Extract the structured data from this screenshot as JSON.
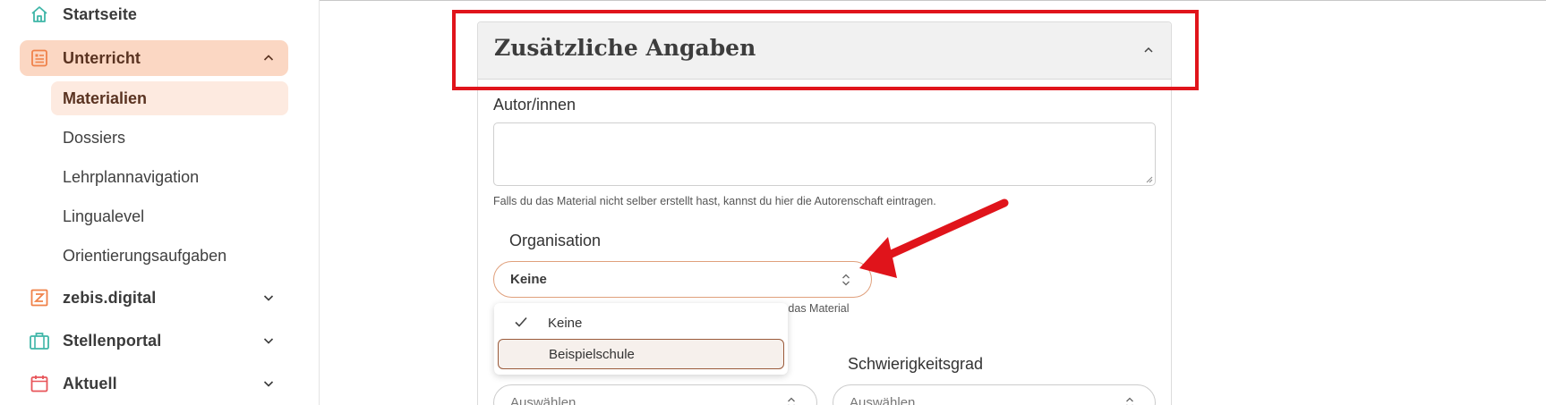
{
  "sidebar": {
    "items": [
      {
        "label": "Startseite",
        "icon": "house-icon"
      },
      {
        "label": "Unterricht",
        "icon": "document-list-icon",
        "expanded": true
      },
      {
        "label": "zebis.digital",
        "icon": "z-logo-icon"
      },
      {
        "label": "Stellenportal",
        "icon": "briefcase-icon"
      },
      {
        "label": "Aktuell",
        "icon": "calendar-icon"
      }
    ],
    "subitems": [
      {
        "label": "Materialien",
        "active": true
      },
      {
        "label": "Dossiers"
      },
      {
        "label": "Lehrplannavigation"
      },
      {
        "label": "Lingualevel"
      },
      {
        "label": "Orientierungsaufgaben"
      }
    ]
  },
  "panel": {
    "title": "Zusätzliche Angaben"
  },
  "authors": {
    "label": "Autor/innen",
    "value": "",
    "hint": "Falls du das Material nicht selber erstellt hast, kannst du hier die Autorenschaft eintragen."
  },
  "organisation": {
    "label": "Organisation",
    "value": "Keine",
    "hint_visible": "n das Material",
    "options": [
      {
        "label": "Keine",
        "selected": true
      },
      {
        "label": "Beispielschule",
        "hovered": true
      }
    ]
  },
  "row_selects": [
    {
      "label": "",
      "value": "Auswählen"
    },
    {
      "label": "Schwierigkeitsgrad",
      "value": "Auswählen"
    }
  ],
  "colors": {
    "accent": "#f0824a",
    "active_bg": "#fbd7c3",
    "sub_active_bg": "#fdeae0",
    "annotation_red": "#e0141b",
    "icon_teal": "#3fb6a8"
  }
}
